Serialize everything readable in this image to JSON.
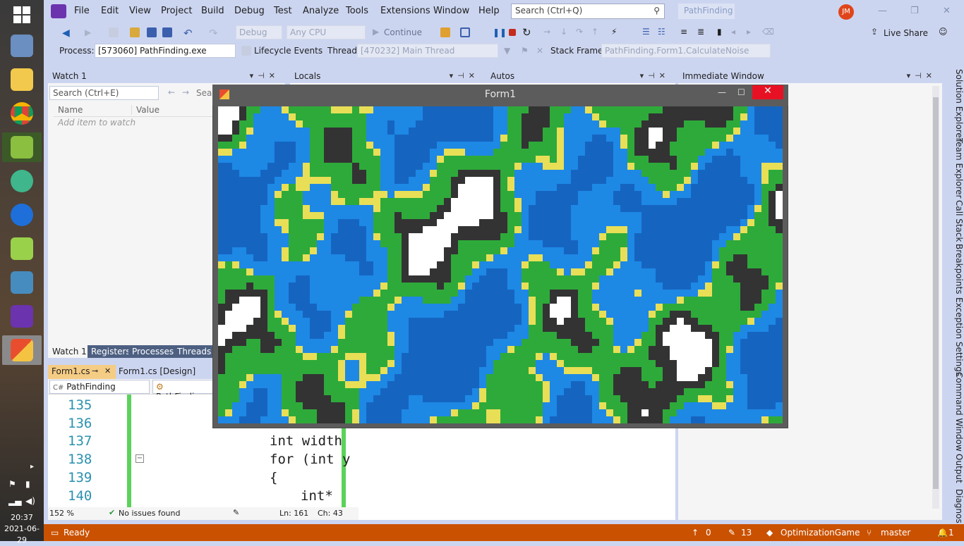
{
  "taskbar": {
    "apps": [
      {
        "name": "start-icon"
      },
      {
        "name": "task-manager-icon"
      },
      {
        "name": "file-explorer-icon"
      },
      {
        "name": "chrome-icon"
      },
      {
        "name": "lambda-app-icon"
      },
      {
        "name": "atom-icon"
      },
      {
        "name": "maps-icon"
      },
      {
        "name": "notepad-plus-icon"
      },
      {
        "name": "godot-icon"
      },
      {
        "name": "visual-studio-icon"
      },
      {
        "name": "form-app-icon"
      }
    ],
    "time": "20:37",
    "date": "2021-06-29"
  },
  "menu": [
    "File",
    "Edit",
    "View",
    "Project",
    "Build",
    "Debug",
    "Test",
    "Analyze",
    "Tools",
    "Extensions",
    "Window",
    "Help"
  ],
  "search": {
    "placeholder": "Search (Ctrl+Q)"
  },
  "solution_name": "PathFinding",
  "user_initials": "JM",
  "toolbar": {
    "config": "Debug",
    "platform": "Any CPU",
    "continue_label": "Continue",
    "live_share": "Live Share"
  },
  "toolbar2": {
    "process_label": "Process:",
    "process_value": "[573060] PathFinding.exe",
    "lifecycle_label": "Lifecycle Events",
    "thread_label": "Thread:",
    "thread_value": "[470232] Main Thread",
    "stackframe_label": "Stack Frame:",
    "stackframe_value": "PathFinding.Form1.CalculateNoise"
  },
  "panels": {
    "watch": "Watch 1",
    "locals": "Locals",
    "autos": "Autos",
    "immediate": "Immediate Window",
    "watch_search": "Search (Ctrl+E)",
    "watch_search_cut": "Sear",
    "col_name": "Name",
    "col_value": "Value",
    "add_item": "Add item to watch",
    "bottom_tabs": [
      "Watch 1",
      "Registers",
      "Processes",
      "Threads"
    ]
  },
  "editor": {
    "tabs": [
      "Form1.cs",
      "Form1.cs [Design]"
    ],
    "nav_left": "PathFinding",
    "nav_right": "PathFinding",
    "line_numbers": [
      "135",
      "136",
      "137",
      "138",
      "139",
      "140"
    ],
    "code": [
      "int width",
      "for (int y",
      "{",
      "int*"
    ],
    "zoom": "152 %",
    "issues": "No issues found",
    "ln": "Ln: 161",
    "ch": "Ch: 43"
  },
  "side_tabs": [
    "Solution Explorer",
    "Team Explorer",
    "Call Stack",
    "Breakpoints",
    "Exception Settings",
    "Command Window",
    "Output",
    "Diagnos"
  ],
  "form1": {
    "title": "Form1"
  },
  "status": {
    "ready": "Ready",
    "up": "0",
    "edits": "13",
    "repo": "OptimizationGame",
    "branch": "master",
    "notif": "1"
  },
  "colors": {
    "deep": "#1565c0",
    "shallow": "#1e88e5",
    "grass": "#2eaa3a",
    "sand": "#e8df57",
    "rock": "#333333",
    "snow": "#ffffff",
    "status": "#ca5100"
  }
}
